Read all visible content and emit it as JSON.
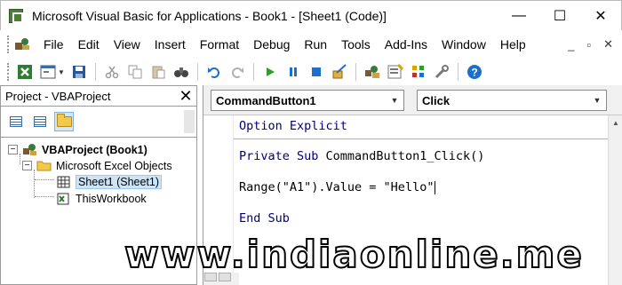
{
  "window": {
    "title": "Microsoft Visual Basic for Applications - Book1 - [Sheet1 (Code)]",
    "controls": {
      "minimize": "—",
      "maximize": "☐",
      "close": "✕"
    }
  },
  "menu": {
    "items": [
      "File",
      "Edit",
      "View",
      "Insert",
      "Format",
      "Debug",
      "Run",
      "Tools",
      "Add-Ins",
      "Window",
      "Help"
    ],
    "right_controls": {
      "minimize": "_",
      "restore": "▫",
      "close": "✕"
    }
  },
  "toolbar": {
    "icons": [
      "view-excel-icon",
      "insert-userform-icon",
      "save-icon",
      "cut-icon",
      "copy-icon",
      "paste-icon",
      "find-icon",
      "undo-icon",
      "redo-icon",
      "run-icon",
      "break-icon",
      "reset-icon",
      "design-mode-icon",
      "project-explorer-icon",
      "properties-window-icon",
      "object-browser-icon",
      "toolbox-icon",
      "help-icon"
    ]
  },
  "project_pane": {
    "title": "Project - VBAProject",
    "close": "✕",
    "tree": {
      "root": "VBAProject (Book1)",
      "folder": "Microsoft Excel Objects",
      "items": [
        "Sheet1 (Sheet1)",
        "ThisWorkbook"
      ]
    }
  },
  "code_window": {
    "object_combo": "CommandButton1",
    "procedure_combo": "Click",
    "lines": {
      "option": "Option Explicit",
      "sub_keyword": "Private Sub",
      "sub_name": " CommandButton1_Click()",
      "body": "Range(\"A1\").Value = \"Hello\"",
      "end_sub": "End Sub"
    }
  },
  "watermark": "www.indiaonline.me",
  "colors": {
    "keyword": "#00007f",
    "selection": "#cce4f7",
    "accent": "#1e6fcc"
  }
}
